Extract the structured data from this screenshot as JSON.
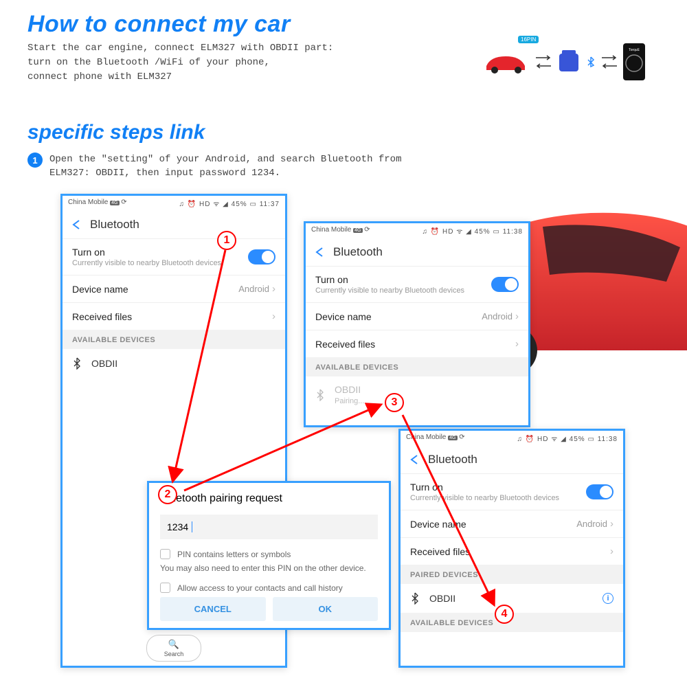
{
  "main_title": "How to connect my car",
  "intro_lines": [
    "Start the car engine, connect ELM327 with OBDII part:",
    "turn on the Bluetooth /WiFi of your phone,",
    "connect phone with ELM327"
  ],
  "sub_title": "specific steps link",
  "step_intro": {
    "num": "1",
    "text": "Open the \"setting\" of your Android, and search Bluetooth from ELM327: OBDII, then input password 1234."
  },
  "diagram_tag": "16PIN",
  "status_bar": {
    "carrier": "China Mobile",
    "carrier_tag": "4G",
    "extra": "⟳",
    "icons": "♫ ⏰ HD ᯤ ◢",
    "battery": "45%",
    "time_a": "11:37",
    "time_b": "11:38"
  },
  "bluetooth_header": "Bluetooth",
  "rows": {
    "turn_on": "Turn on",
    "turn_on_sub": "Currently visible to nearby Bluetooth devices",
    "device_name": "Device name",
    "device_val": "Android",
    "received": "Received files"
  },
  "sections": {
    "available": "AVAILABLE DEVICES",
    "paired": "PAIRED DEVICES"
  },
  "device": {
    "name": "OBDII",
    "pairing": "Pairing..."
  },
  "search": "Search",
  "dialog": {
    "title": "Bluetooth pairing request",
    "value": "1234",
    "check1": "PIN contains letters or symbols",
    "note": "You may also need to enter this PIN on the other device.",
    "check2": "Allow access to your contacts and call history",
    "cancel": "CANCEL",
    "ok": "OK"
  },
  "circles": {
    "c1": "1",
    "c2": "2",
    "c3": "3",
    "c4": "4"
  }
}
